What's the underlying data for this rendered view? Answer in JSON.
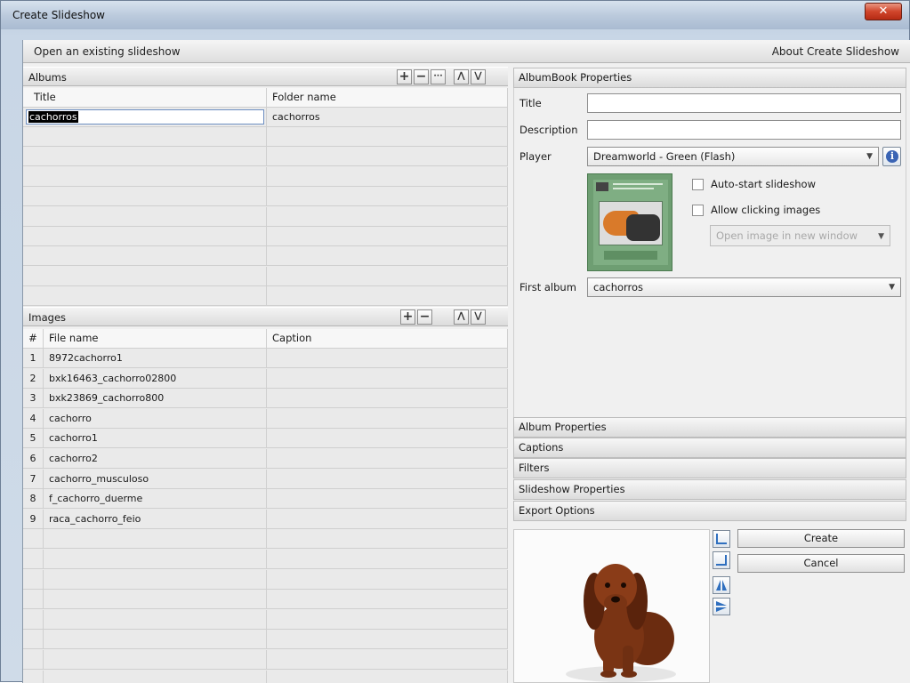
{
  "window": {
    "title": "Create Slideshow",
    "close_glyph": "✕"
  },
  "topbar": {
    "open_label": "Open an existing slideshow",
    "about_label": "About Create Slideshow"
  },
  "albums": {
    "header": "Albums",
    "columns": [
      "Title",
      "Folder name"
    ],
    "rows": [
      {
        "title": "cachorros",
        "folder": "cachorros"
      }
    ],
    "editing_value": "cachorros"
  },
  "images": {
    "header": "Images",
    "columns": [
      "#",
      "File name",
      "Caption"
    ],
    "rows": [
      {
        "num": "1",
        "file": "8972cachorro1",
        "caption": ""
      },
      {
        "num": "2",
        "file": "bxk16463_cachorro02800",
        "caption": ""
      },
      {
        "num": "3",
        "file": "bxk23869_cachorro800",
        "caption": ""
      },
      {
        "num": "4",
        "file": "cachorro",
        "caption": ""
      },
      {
        "num": "5",
        "file": "cachorro1",
        "caption": ""
      },
      {
        "num": "6",
        "file": "cachorro2",
        "caption": ""
      },
      {
        "num": "7",
        "file": "cachorro_musculoso",
        "caption": ""
      },
      {
        "num": "8",
        "file": "f_cachorro_duerme",
        "caption": ""
      },
      {
        "num": "9",
        "file": "raca_cachorro_feio",
        "caption": ""
      }
    ]
  },
  "toolbar_glyphs": {
    "add": "+",
    "remove": "−",
    "more": "···",
    "up": "⋀",
    "down": "⋁"
  },
  "albumbook": {
    "header": "AlbumBook Properties",
    "title_label": "Title",
    "title_value": "",
    "description_label": "Description",
    "description_value": "",
    "player_label": "Player",
    "player_value": "Dreamworld - Green (Flash)",
    "autostart_label": "Auto-start slideshow",
    "allow_click_label": "Allow clicking images",
    "open_image_value": "Open image in new window",
    "first_album_label": "First album",
    "first_album_value": "cachorros",
    "info_glyph": "i",
    "dropdown_glyph": "▼"
  },
  "sections": [
    "Album Properties",
    "Captions",
    "Filters",
    "Slideshow Properties",
    "Export Options"
  ],
  "buttons": {
    "create": "Create",
    "cancel": "Cancel"
  },
  "colors": {
    "selection": "#000000",
    "player_preview_green": "#6e9e72",
    "close_red": "#c8412a"
  }
}
